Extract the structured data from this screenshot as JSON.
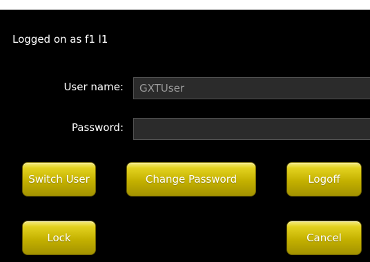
{
  "status": {
    "logged_on_text": "Logged on as f1 l1"
  },
  "form": {
    "username_label": "User name:",
    "username_value": "GXTUser",
    "password_label": "Password:",
    "password_value": ""
  },
  "buttons": {
    "switch_user": "Switch User",
    "change_password": "Change Password",
    "logoff": "Logoff",
    "lock": "Lock",
    "cancel": "Cancel"
  },
  "colors": {
    "background": "#000000",
    "button_accent": "#d4c000",
    "field_background": "#2b2b2b"
  }
}
